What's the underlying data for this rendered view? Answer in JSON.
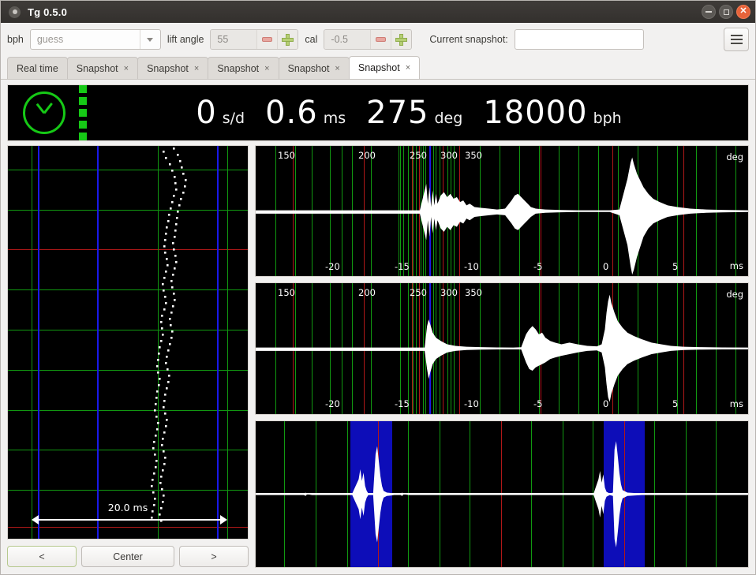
{
  "window": {
    "title": "Tg 0.5.0",
    "app_icon": "microphone-icon",
    "buttons": {
      "minimize": "minimize-icon",
      "maximize": "maximize-icon",
      "close": "close-icon"
    }
  },
  "toolbar": {
    "bph_label": "bph",
    "bph_value": "guess",
    "lift_angle_label": "lift angle",
    "lift_angle_value": "55",
    "cal_label": "cal",
    "cal_value": "-0.5",
    "snapshot_label": "Current snapshot:",
    "snapshot_value": "",
    "snapshot_placeholder": "",
    "menu_icon": "hamburger-menu-icon",
    "minus_icon": "minus-icon",
    "plus_icon": "plus-icon"
  },
  "tabs": [
    {
      "label": "Real time",
      "closable": false,
      "active": false
    },
    {
      "label": "Snapshot",
      "closable": true,
      "active": false,
      "close": "×"
    },
    {
      "label": "Snapshot",
      "closable": true,
      "active": false,
      "close": "×"
    },
    {
      "label": "Snapshot",
      "closable": true,
      "active": false,
      "close": "×"
    },
    {
      "label": "Snapshot",
      "closable": true,
      "active": false,
      "close": "×"
    },
    {
      "label": "Snapshot",
      "closable": true,
      "active": true,
      "close": "×"
    }
  ],
  "readout": {
    "clock_icon": "clock-icon",
    "signal_icon": "signal-strength-icon",
    "rate": {
      "value": "0",
      "unit": "s/d"
    },
    "beat_error": {
      "value": "0.6",
      "unit": "ms"
    },
    "amplitude": {
      "value": "275",
      "unit": "deg"
    },
    "bph": {
      "value": "18000",
      "unit": "bph"
    }
  },
  "paperstrip": {
    "span_label": "20.0 ms",
    "arrow_icon": "double-arrow-icon",
    "prev_label": "<",
    "center_label": "Center",
    "next_label": ">"
  },
  "colors": {
    "grid_green": "#119911",
    "grid_red": "#b01818",
    "marker_blue": "#1919e8",
    "band_blue": "#0d0db8",
    "trace_white": "#ffffff",
    "panel_bg": "#000000",
    "accent_green": "#16c916",
    "close_orange": "#e8633a"
  },
  "chart_data": [
    {
      "id": "paperstrip",
      "type": "scatter",
      "title": "",
      "xlabel": "",
      "ylabel": "",
      "span_ms": 20.0,
      "grid": true,
      "notes": "Beat-rate paperstrip: white dot trace scrolls downward; vertical green/blue reference lines; horizontal green grid with red center lines.",
      "vertical_lines": [
        {
          "x_pct": 9.8,
          "color": "#119911"
        },
        {
          "x_pct": 12.5,
          "color": "#1919e8"
        },
        {
          "x_pct": 37.3,
          "color": "#1919e8"
        },
        {
          "x_pct": 62.5,
          "color": "#119911"
        },
        {
          "x_pct": 87.2,
          "color": "#1919e8"
        },
        {
          "x_pct": 91.4,
          "color": "#119911"
        }
      ],
      "horizontal_lines": [
        {
          "y_pct": 6.0,
          "color": "#119911"
        },
        {
          "y_pct": 16.2,
          "color": "#119911"
        },
        {
          "y_pct": 26.4,
          "color": "#b01818"
        },
        {
          "y_pct": 36.6,
          "color": "#119911"
        },
        {
          "y_pct": 46.8,
          "color": "#119911"
        },
        {
          "y_pct": 57.0,
          "color": "#119911"
        },
        {
          "y_pct": 67.2,
          "color": "#119911"
        },
        {
          "y_pct": 77.4,
          "color": "#119911"
        },
        {
          "y_pct": 87.6,
          "color": "#119911"
        },
        {
          "y_pct": 97.0,
          "color": "#b01818"
        }
      ]
    },
    {
      "id": "tic-waveform",
      "type": "area",
      "title": "",
      "xlabel": "ms",
      "ylabel": "deg",
      "x_ticks_ms": [
        -20,
        -15,
        -10,
        -5,
        0,
        5
      ],
      "deg_ticks": [
        150,
        200,
        250,
        300,
        350
      ],
      "xlim_ms": [
        -24,
        7
      ],
      "marker_ms": -13.6,
      "grid": true,
      "notes": "Upper waveform: small burst near -13.5 ms, medium burst near -9 ms, large burst at 0 ms."
    },
    {
      "id": "toc-waveform",
      "type": "area",
      "title": "",
      "xlabel": "ms",
      "ylabel": "deg",
      "x_ticks_ms": [
        -20,
        -15,
        -10,
        -5,
        0,
        5
      ],
      "deg_ticks": [
        150,
        200,
        250,
        300,
        350
      ],
      "xlim_ms": [
        -24,
        7
      ],
      "marker_ms": -13.6,
      "grid": true,
      "notes": "Lower waveform: sharp spike at -13.5 ms, broad burst near -5 ms, large burst at 0 ms."
    },
    {
      "id": "beat-overview",
      "type": "area",
      "title": "",
      "xlabel": "",
      "ylabel": "",
      "grid": true,
      "highlight_bands": [
        {
          "x_pct": 19.2,
          "w_pct": 8.6
        },
        {
          "x_pct": 70.6,
          "w_pct": 8.4
        }
      ],
      "notes": "Full-beat overview: two blue selection bands each containing a tic/toc spike pair."
    }
  ]
}
